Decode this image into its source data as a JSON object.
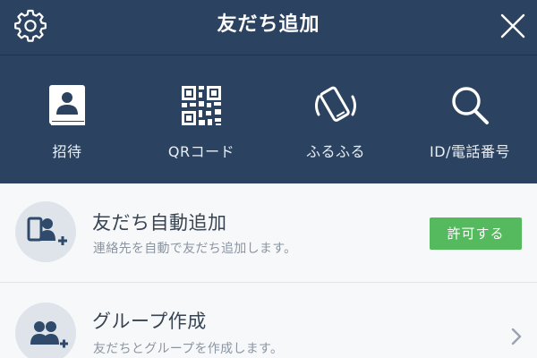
{
  "header": {
    "title": "友だち追加",
    "settings_icon": "gear-icon",
    "close_icon": "close-icon",
    "background": "#2b4360"
  },
  "actions": [
    {
      "label": "招待",
      "icon": "contact-book-icon"
    },
    {
      "label": "QRコード",
      "icon": "qr-code-icon"
    },
    {
      "label": "ふるふる",
      "icon": "shake-phone-icon"
    },
    {
      "label": "ID/電話番号",
      "icon": "search-icon"
    }
  ],
  "list": {
    "auto_add": {
      "title": "友だち自動追加",
      "subtitle": "連絡先を自動で友だち追加します。",
      "button_label": "許可する",
      "button_color": "#55b95e",
      "icon": "phone-person-add-icon"
    },
    "create_group": {
      "title": "グループ作成",
      "subtitle": "友だちとグループを作成します。",
      "icon": "group-add-icon",
      "chevron_icon": "chevron-right-icon"
    }
  }
}
